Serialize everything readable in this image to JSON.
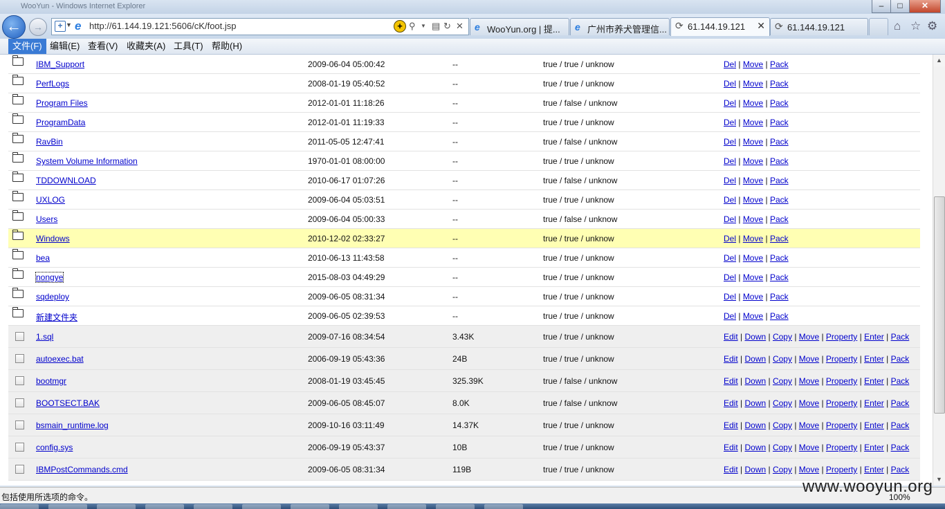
{
  "window": {
    "title": "WooYun - Windows Internet Explorer"
  },
  "address_bar": {
    "url": "http://61.144.19.121:5606/cK/foot.jsp"
  },
  "tabs": [
    {
      "label": "WooYun.org | 提...",
      "active": false,
      "loading": false,
      "closable": false
    },
    {
      "label": "广州市养犬管理信...",
      "active": false,
      "loading": false,
      "closable": false
    },
    {
      "label": "61.144.19.121",
      "active": true,
      "loading": true,
      "closable": true
    },
    {
      "label": "61.144.19.121",
      "active": false,
      "loading": true,
      "closable": false
    }
  ],
  "menu": [
    {
      "label": "文件(F)",
      "active": true
    },
    {
      "label": "编辑(E)",
      "active": false
    },
    {
      "label": "查看(V)",
      "active": false
    },
    {
      "label": "收藏夹(A)",
      "active": false
    },
    {
      "label": "工具(T)",
      "active": false
    },
    {
      "label": "帮助(H)",
      "active": false
    }
  ],
  "dir_actions": [
    "Del",
    "Move",
    "Pack"
  ],
  "file_actions": [
    "Edit",
    "Down",
    "Copy",
    "Move",
    "Property",
    "Enter",
    "Pack"
  ],
  "directories": [
    {
      "name": "IBM_Support",
      "date": "2009-06-04 05:00:42",
      "size": "--",
      "perm": "true / true / unknow"
    },
    {
      "name": "PerfLogs",
      "date": "2008-01-19 05:40:52",
      "size": "--",
      "perm": "true / true / unknow"
    },
    {
      "name": "Program Files",
      "date": "2012-01-01 11:18:26",
      "size": "--",
      "perm": "true / false / unknow"
    },
    {
      "name": "ProgramData",
      "date": "2012-01-01 11:19:33",
      "size": "--",
      "perm": "true / true / unknow"
    },
    {
      "name": "RavBin",
      "date": "2011-05-05 12:47:41",
      "size": "--",
      "perm": "true / false / unknow"
    },
    {
      "name": "System Volume Information",
      "date": "1970-01-01 08:00:00",
      "size": "--",
      "perm": "true / true / unknow"
    },
    {
      "name": "TDDOWNLOAD",
      "date": "2010-06-17 01:07:26",
      "size": "--",
      "perm": "true / false / unknow"
    },
    {
      "name": "UXLOG",
      "date": "2009-06-04 05:03:51",
      "size": "--",
      "perm": "true / true / unknow"
    },
    {
      "name": "Users",
      "date": "2009-06-04 05:00:33",
      "size": "--",
      "perm": "true / false / unknow"
    },
    {
      "name": "Windows",
      "date": "2010-12-02 02:33:27",
      "size": "--",
      "perm": "true / true / unknow",
      "highlight": true
    },
    {
      "name": "bea",
      "date": "2010-06-13 11:43:58",
      "size": "--",
      "perm": "true / true / unknow"
    },
    {
      "name": "nongye",
      "date": "2015-08-03 04:49:29",
      "size": "--",
      "perm": "true / true / unknow",
      "focused": true
    },
    {
      "name": "sqdeploy",
      "date": "2009-06-05 08:31:34",
      "size": "--",
      "perm": "true / true / unknow"
    },
    {
      "name": "新建文件夹",
      "date": "2009-06-05 02:39:53",
      "size": "--",
      "perm": "true / true / unknow"
    }
  ],
  "files": [
    {
      "name": "1.sql",
      "date": "2009-07-16 08:34:54",
      "size": "3.43K",
      "perm": "true / true / unknow"
    },
    {
      "name": "autoexec.bat",
      "date": "2006-09-19 05:43:36",
      "size": "24B",
      "perm": "true / true / unknow"
    },
    {
      "name": "bootmgr",
      "date": "2008-01-19 03:45:45",
      "size": "325.39K",
      "perm": "true / false / unknow"
    },
    {
      "name": "BOOTSECT.BAK",
      "date": "2009-06-05 08:45:07",
      "size": "8.0K",
      "perm": "true / false / unknow"
    },
    {
      "name": "bsmain_runtime.log",
      "date": "2009-10-16 03:11:49",
      "size": "14.37K",
      "perm": "true / true / unknow"
    },
    {
      "name": "config.sys",
      "date": "2006-09-19 05:43:37",
      "size": "10B",
      "perm": "true / true / unknow"
    },
    {
      "name": "IBMPostCommands.cmd",
      "date": "2009-06-05 08:31:34",
      "size": "119B",
      "perm": "true / true / unknow"
    }
  ],
  "status": {
    "text": "包括使用所选项的命令。",
    "zoom": "100%"
  },
  "watermark": "www.wooyun.org"
}
